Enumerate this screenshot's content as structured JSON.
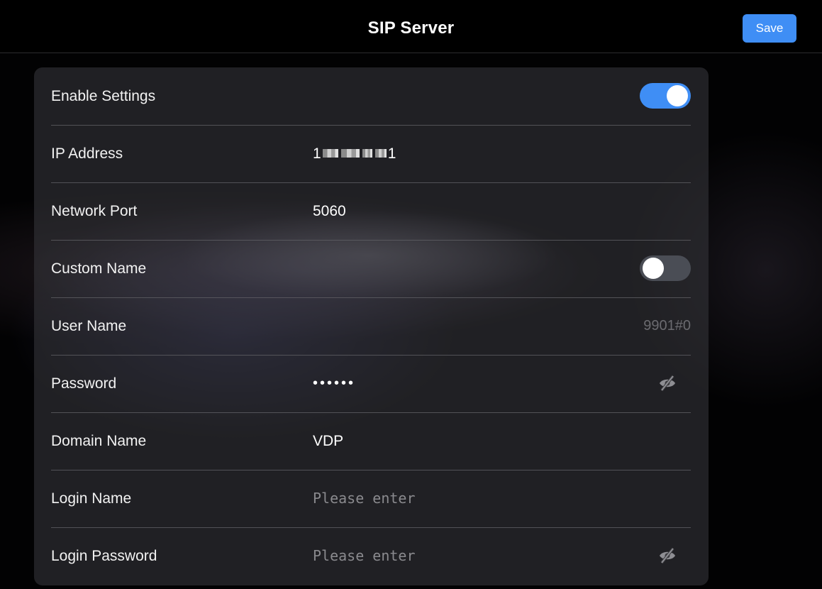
{
  "header": {
    "title": "SIP Server",
    "save_label": "Save"
  },
  "form": {
    "enable_settings": {
      "label": "Enable Settings",
      "enabled": true
    },
    "ip_address": {
      "label": "IP Address",
      "first": "1",
      "last": "1"
    },
    "network_port": {
      "label": "Network Port",
      "value": "5060"
    },
    "custom_name": {
      "label": "Custom Name",
      "enabled": false
    },
    "user_name": {
      "label": "User Name",
      "value": "9901#0"
    },
    "password": {
      "label": "Password",
      "masked": "••••••"
    },
    "domain_name": {
      "label": "Domain Name",
      "value": "VDP"
    },
    "login_name": {
      "label": "Login Name",
      "placeholder": "Please enter"
    },
    "login_password": {
      "label": "Login Password",
      "placeholder": "Please enter"
    }
  },
  "icons": {
    "password_visibility": "eye-slash-icon",
    "login_password_visibility": "eye-slash-icon"
  },
  "colors": {
    "accent": "#3f8ef5",
    "toggle_off": "#4a4d55"
  }
}
